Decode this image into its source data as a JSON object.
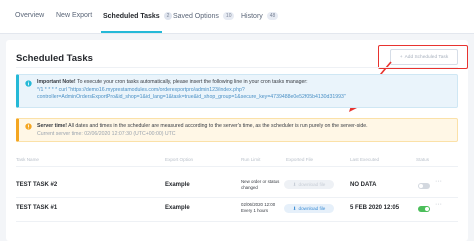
{
  "tabs": [
    {
      "label": "Overview",
      "badge": ""
    },
    {
      "label": "New Export",
      "badge": ""
    },
    {
      "label": "Scheduled Tasks",
      "badge": "2"
    },
    {
      "label": "Saved Options",
      "badge": "10"
    },
    {
      "label": "History",
      "badge": "48"
    }
  ],
  "page_title": "Scheduled Tasks",
  "add_button_label": "Add Scheduled Task",
  "info_alert": {
    "title": "Important Note!",
    "message": "To execute your cron tasks automatically, please insert the following line in your cron tasks manager:",
    "command": "*/1 * * * * curl \"https://demo16.myprestamodules.com/orderexportpro/admin123/index.php?controller=AdminOrdersExportPro&id_shop=1&id_lang=1&task=true&id_shop_group=1&secure_key=4739488e0e52f05b4130d31993\""
  },
  "warning_alert": {
    "title": "Server time!",
    "message": "All dates and times in the scheduler are measured according to the server's time, as the scheduler is run purely on the server-side.",
    "current_time": "Current server time: 02/06/2020 12:07:30 (UTC+00:00) UTC"
  },
  "table": {
    "headers": [
      "Task Name",
      "Export Option",
      "Run Limit",
      "Exported File",
      "Last Executed",
      "Status"
    ],
    "rows": [
      {
        "name": "TEST TASK #2",
        "option": "Example",
        "run_info": "New order or status changed",
        "file_button": "download file",
        "file_enabled": false,
        "last_executed": "NO DATA",
        "status_on": false
      },
      {
        "name": "TEST TASK #1",
        "option": "Example",
        "run_info": "02/06/2020 12:00 Every 1 hours",
        "file_button": "download file",
        "file_enabled": true,
        "last_executed": "5 FEB 2020 12:05",
        "status_on": true
      }
    ]
  },
  "colors": {
    "accent": "#25b9d7",
    "highlight": "#e8332f",
    "warning": "#f4a622",
    "success": "#4bbe5a"
  }
}
